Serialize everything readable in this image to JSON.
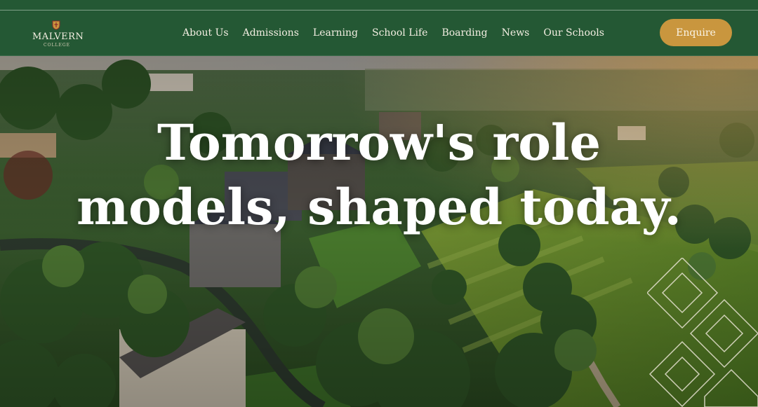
{
  "brand": {
    "name": "MALVERN",
    "subtitle": "COLLEGE"
  },
  "nav": {
    "items": [
      {
        "label": "About Us"
      },
      {
        "label": "Admissions"
      },
      {
        "label": "Learning"
      },
      {
        "label": "School Life"
      },
      {
        "label": "Boarding"
      },
      {
        "label": "News"
      },
      {
        "label": "Our Schools"
      }
    ],
    "cta_label": "Enquire"
  },
  "hero": {
    "headline_line1": "Tomorrow's role",
    "headline_line2": "models, shaped today."
  },
  "colors": {
    "header_green": "#245834",
    "cta_gold": "#c9963e",
    "headline_white": "#ffffff"
  },
  "icons": {
    "crest": "crest-icon",
    "pattern": "diamond-pattern"
  }
}
